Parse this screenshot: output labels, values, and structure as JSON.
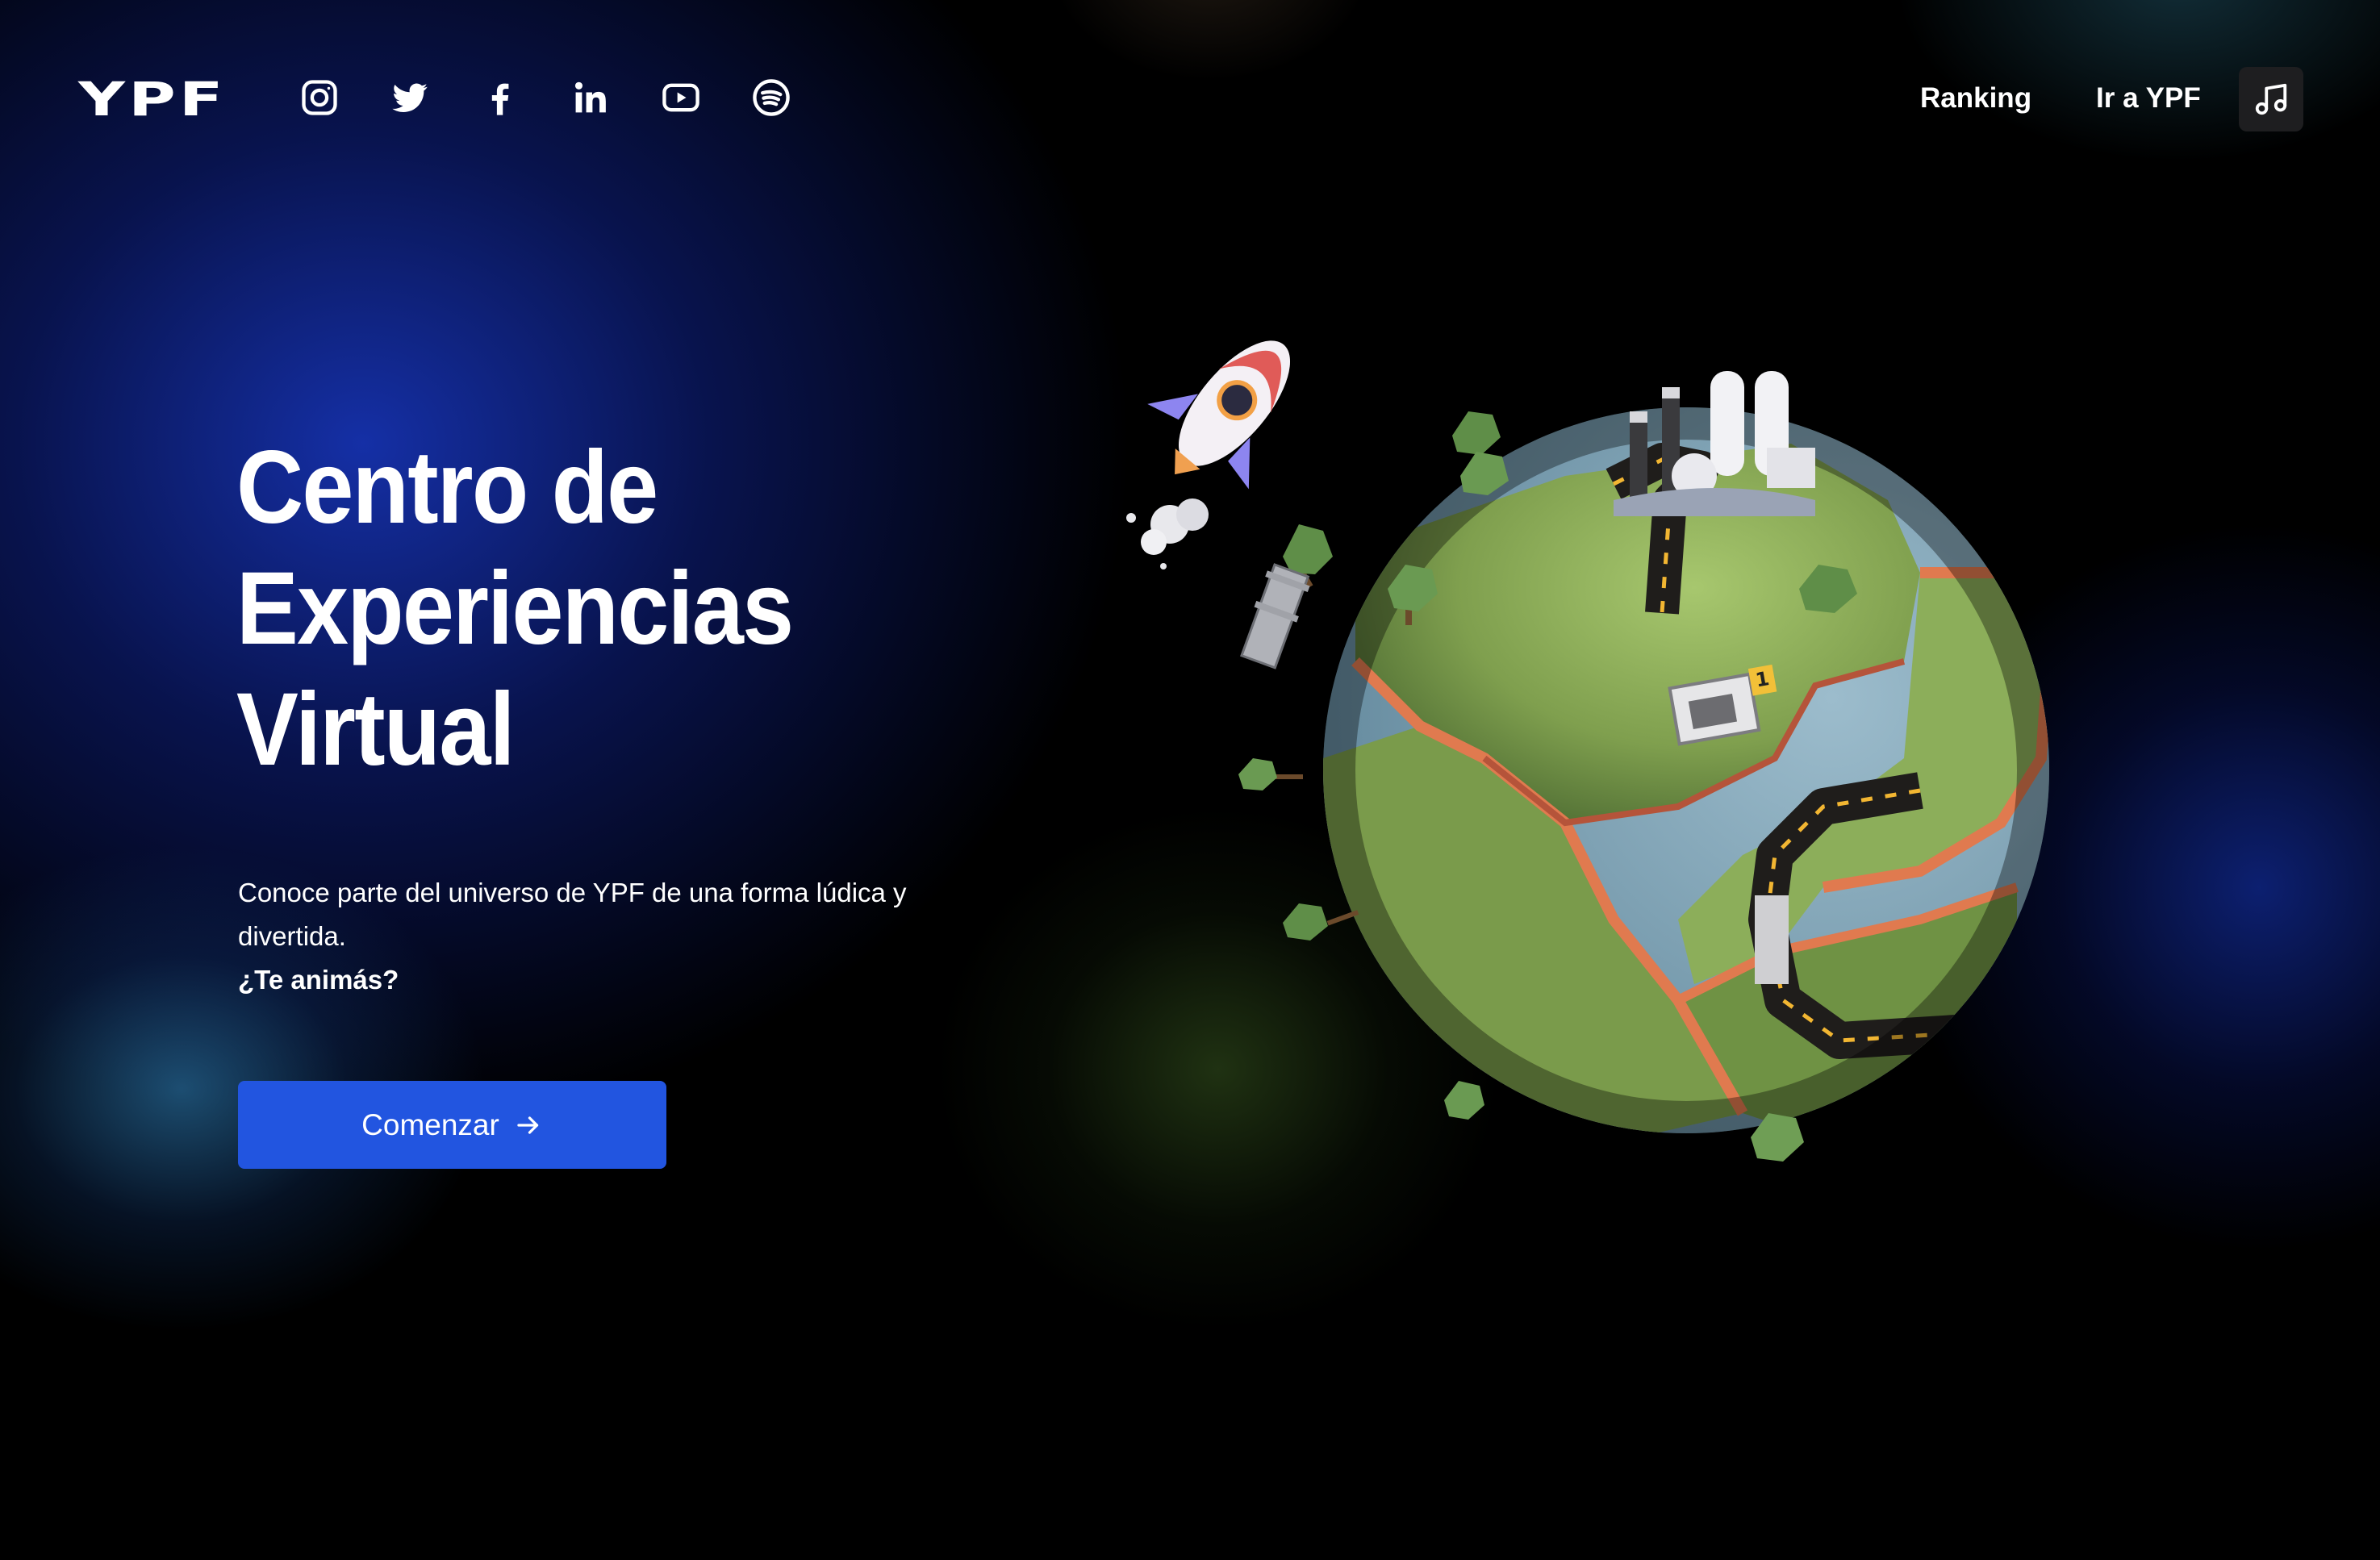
{
  "brand": {
    "logo_text": "YPF"
  },
  "social": [
    {
      "name": "instagram-icon"
    },
    {
      "name": "twitter-icon"
    },
    {
      "name": "facebook-icon"
    },
    {
      "name": "linkedin-icon"
    },
    {
      "name": "youtube-icon"
    },
    {
      "name": "spotify-icon"
    }
  ],
  "nav": {
    "ranking_label": "Ranking",
    "ypf_label": "Ir a YPF",
    "music_icon": "music-note-icon"
  },
  "hero": {
    "title_line1": "Centro de",
    "title_line2": "Experiencias",
    "title_line3": "Virtual",
    "description": "Conoce parte del universo de YPF de una forma lúdica y divertida.",
    "cta_text": "¿Te animás?",
    "button_label": "Comenzar",
    "button_icon": "arrow-right-icon"
  },
  "colors": {
    "background": "#000000",
    "primary_button": "#2255e0",
    "glow_blue": "#1632af",
    "planet_green": "#8cae5a",
    "planet_water": "#6e9ab0",
    "road_orange": "#e07a4f"
  }
}
